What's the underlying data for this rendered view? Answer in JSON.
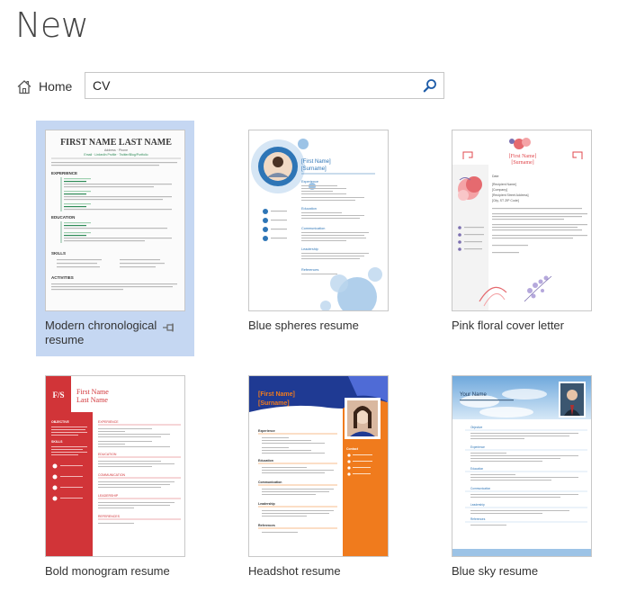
{
  "header": {
    "title": "New"
  },
  "nav": {
    "home_label": "Home"
  },
  "search": {
    "value": "CV",
    "icon": "search-icon"
  },
  "templates": [
    {
      "label": "Modern chronological resume",
      "selected": true,
      "pinned": true
    },
    {
      "label": "Blue spheres resume"
    },
    {
      "label": "Pink floral cover letter"
    },
    {
      "label": "Bold monogram resume"
    },
    {
      "label": "Headshot resume"
    },
    {
      "label": "Blue sky resume"
    }
  ],
  "thumbs": {
    "modern": {
      "name": "FIRST NAME LAST NAME",
      "sub": "Address · Phone",
      "contact": "Email · LinkedIn Profile · Twitter/Blog/Portfolio",
      "sections": [
        "EXPERIENCE",
        "EDUCATION",
        "SKILLS",
        "ACTIVITIES"
      ]
    },
    "spheres": {
      "name": "[First Name]",
      "surname": "[Surname]",
      "sections": [
        "Experience",
        "Education",
        "Communication",
        "Leadership",
        "References"
      ]
    },
    "floral": {
      "name": "[First Name]",
      "surname": "[Surname]",
      "date": "Date",
      "recipient": "[Recipient Name]",
      "company": "[Company]",
      "lines": [
        "[Recipient Street Address]",
        "[City, ST ZIP Code]"
      ]
    },
    "monogram": {
      "initials": "F/S",
      "name": "First Name",
      "surname": "Last Name",
      "left_sections": [
        "OBJECTIVE",
        "SKILLS"
      ],
      "right_sections": [
        "EXPERIENCE",
        "EDUCATION",
        "COMMUNICATION",
        "LEADERSHIP",
        "REFERENCES"
      ]
    },
    "headshot": {
      "name": "[First Name]",
      "surname": "[Surname]",
      "sections": [
        "Experience",
        "Education",
        "Communication",
        "Leadership",
        "References"
      ],
      "side": "Contact"
    },
    "bluesky": {
      "name": "Your Name",
      "sections": [
        "Objective",
        "Experience",
        "Education",
        "Communication",
        "Leadership",
        "References"
      ]
    }
  },
  "colors": {
    "selected_bg": "#c5d7f2",
    "modern_accent": "#2e8b57",
    "spheres_blue": "#2e75b6",
    "floral_pink": "#e0474c",
    "monogram_red": "#d13438",
    "headshot_orange": "#f07b1d",
    "headshot_navy": "#1f3a93",
    "sky_blue": "#9cc3e6"
  }
}
